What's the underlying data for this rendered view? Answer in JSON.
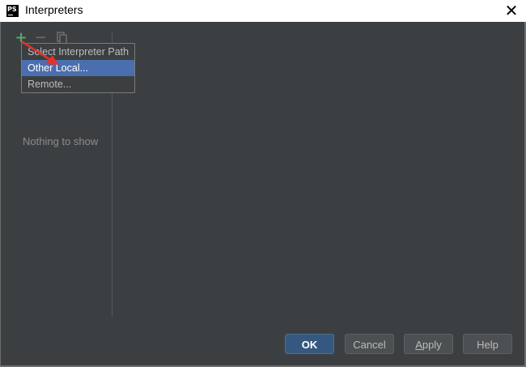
{
  "window": {
    "title": "Interpreters",
    "app_icon_text": "PS",
    "close_glyph": "✕"
  },
  "toolbar": {
    "add_glyph": "+",
    "remove_glyph": "−",
    "add_icon": "plus-icon",
    "remove_icon": "minus-icon",
    "copy_icon": "copy-icon"
  },
  "list": {
    "empty_text": "Nothing to show"
  },
  "dropdown": {
    "items": [
      {
        "label": "Select Interpreter Path"
      },
      {
        "label": "Other Local..."
      },
      {
        "label": "Remote..."
      }
    ],
    "selected_index": 1
  },
  "buttons": {
    "ok": "OK",
    "cancel": "Cancel",
    "apply_mnemonic": "A",
    "apply_rest": "pply",
    "help": "Help"
  },
  "colors": {
    "panel_bg": "#3c3f41",
    "selection": "#4b6eaf",
    "add_green": "#59a869",
    "annotation_arrow": "#e8302a"
  }
}
